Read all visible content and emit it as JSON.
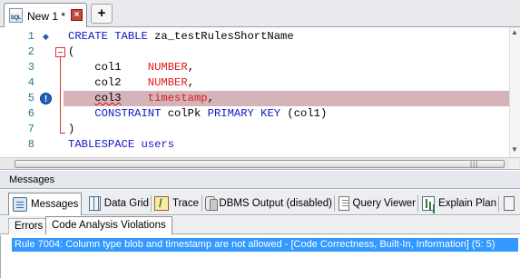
{
  "document_tabs": [
    {
      "label": "New 1 *",
      "icon": "sql-file-icon",
      "icon_text": "SQL",
      "active": true
    }
  ],
  "add_tab_label": "+",
  "close_label": "×",
  "editor": {
    "line_numbers": [
      "1",
      "2",
      "3",
      "4",
      "5",
      "6",
      "7",
      "8"
    ],
    "highlight_line": 5,
    "code": [
      "CREATE TABLE za_testRulesShortName",
      "(",
      "col1 NUMBER,",
      "col2 NUMBER,",
      "col3 timestamp,",
      "CONSTRAINT colPk PRIMARY KEY (col1)",
      ")",
      "TABLESPACE users"
    ],
    "line1": {
      "kw": "CREATE TABLE",
      "name": "za_testRulesShortName"
    },
    "line2": {
      "paren": "("
    },
    "line3": {
      "col": "col1",
      "type": "NUMBER",
      "punct": ","
    },
    "line4": {
      "col": "col2",
      "type": "NUMBER",
      "punct": ","
    },
    "line5": {
      "col": "col3",
      "type": "timestamp",
      "punct": ","
    },
    "line6": {
      "kw1": "CONSTRAINT",
      "name": "colPk",
      "kw2": "PRIMARY KEY",
      "args": "(col1)"
    },
    "line7": {
      "paren": ")"
    },
    "line8": {
      "kw": "TABLESPACE",
      "name": "users"
    },
    "colors": {
      "keyword": "#1517c4",
      "datatype": "#e01b1b",
      "line_number": "#2b7a8a",
      "highlight": "#d4b4b8",
      "fold": "#e03030"
    }
  },
  "messages_panel": {
    "title": "Messages",
    "tabs": [
      {
        "label": "Messages",
        "icon": "messages-icon",
        "active": true
      },
      {
        "label": "Data Grid",
        "icon": "data-grid-icon"
      },
      {
        "label": "Trace",
        "icon": "trace-icon"
      },
      {
        "label": "DBMS Output (disabled)",
        "icon": "dbms-output-icon"
      },
      {
        "label": "Query Viewer",
        "icon": "query-viewer-icon"
      },
      {
        "label": "Explain Plan",
        "icon": "explain-plan-icon"
      }
    ],
    "sub_tabs": [
      {
        "label": "Errors",
        "active": false
      },
      {
        "label": "Code Analysis Violations",
        "active": true
      }
    ],
    "violations": [
      "Rule 7004: Column type  blob and timestamp are not allowed - [Code Correctness, Built-In, Information] (5: 5)"
    ],
    "selection_color": "#3399ff"
  }
}
